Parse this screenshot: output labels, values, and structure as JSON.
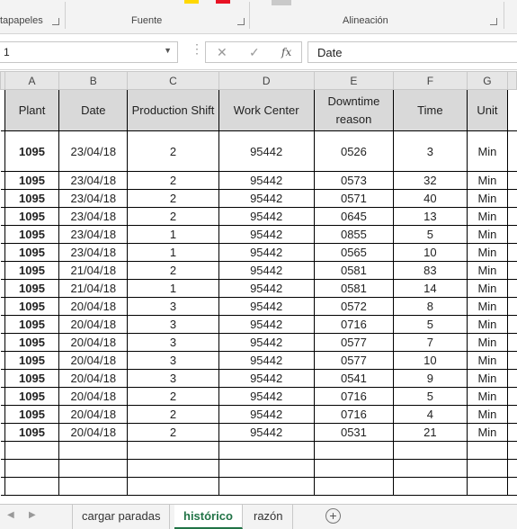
{
  "ribbon": {
    "group_clipboard": "tapapeles",
    "group_font": "Fuente",
    "group_alignment": "Alineación",
    "font_color": "#e81123",
    "highlight_color": "#ffd800"
  },
  "formula_bar": {
    "name_box": "1",
    "formula_value": "Date",
    "cancel_icon": "✕",
    "enter_icon": "✓",
    "fx_label": "fx"
  },
  "columns": [
    "A",
    "B",
    "C",
    "D",
    "E",
    "F",
    "G"
  ],
  "headers": {
    "plant": "Plant",
    "date": "Date",
    "shift": "Production Shift",
    "work_center": "Work Center",
    "downtime": "Downtime reason",
    "time": "Time",
    "unit": "Unit"
  },
  "rows": [
    {
      "plant": "1095",
      "date": "23/04/18",
      "shift": "2",
      "wc": "95442",
      "reason": "0526",
      "time": "3",
      "unit": "Min"
    },
    {
      "plant": "1095",
      "date": "23/04/18",
      "shift": "2",
      "wc": "95442",
      "reason": "0573",
      "time": "32",
      "unit": "Min"
    },
    {
      "plant": "1095",
      "date": "23/04/18",
      "shift": "2",
      "wc": "95442",
      "reason": "0571",
      "time": "40",
      "unit": "Min"
    },
    {
      "plant": "1095",
      "date": "23/04/18",
      "shift": "2",
      "wc": "95442",
      "reason": "0645",
      "time": "13",
      "unit": "Min"
    },
    {
      "plant": "1095",
      "date": "23/04/18",
      "shift": "1",
      "wc": "95442",
      "reason": "0855",
      "time": "5",
      "unit": "Min"
    },
    {
      "plant": "1095",
      "date": "23/04/18",
      "shift": "1",
      "wc": "95442",
      "reason": "0565",
      "time": "10",
      "unit": "Min"
    },
    {
      "plant": "1095",
      "date": "21/04/18",
      "shift": "2",
      "wc": "95442",
      "reason": "0581",
      "time": "83",
      "unit": "Min"
    },
    {
      "plant": "1095",
      "date": "21/04/18",
      "shift": "1",
      "wc": "95442",
      "reason": "0581",
      "time": "14",
      "unit": "Min"
    },
    {
      "plant": "1095",
      "date": "20/04/18",
      "shift": "3",
      "wc": "95442",
      "reason": "0572",
      "time": "8",
      "unit": "Min"
    },
    {
      "plant": "1095",
      "date": "20/04/18",
      "shift": "3",
      "wc": "95442",
      "reason": "0716",
      "time": "5",
      "unit": "Min"
    },
    {
      "plant": "1095",
      "date": "20/04/18",
      "shift": "3",
      "wc": "95442",
      "reason": "0577",
      "time": "7",
      "unit": "Min"
    },
    {
      "plant": "1095",
      "date": "20/04/18",
      "shift": "3",
      "wc": "95442",
      "reason": "0577",
      "time": "10",
      "unit": "Min"
    },
    {
      "plant": "1095",
      "date": "20/04/18",
      "shift": "3",
      "wc": "95442",
      "reason": "0541",
      "time": "9",
      "unit": "Min"
    },
    {
      "plant": "1095",
      "date": "20/04/18",
      "shift": "2",
      "wc": "95442",
      "reason": "0716",
      "time": "5",
      "unit": "Min"
    },
    {
      "plant": "1095",
      "date": "20/04/18",
      "shift": "2",
      "wc": "95442",
      "reason": "0716",
      "time": "4",
      "unit": "Min"
    },
    {
      "plant": "1095",
      "date": "20/04/18",
      "shift": "2",
      "wc": "95442",
      "reason": "0531",
      "time": "21",
      "unit": "Min"
    }
  ],
  "tabs": {
    "tab1": "cargar paradas",
    "tab2": "histórico",
    "tab3": "razón",
    "active": "histórico"
  }
}
